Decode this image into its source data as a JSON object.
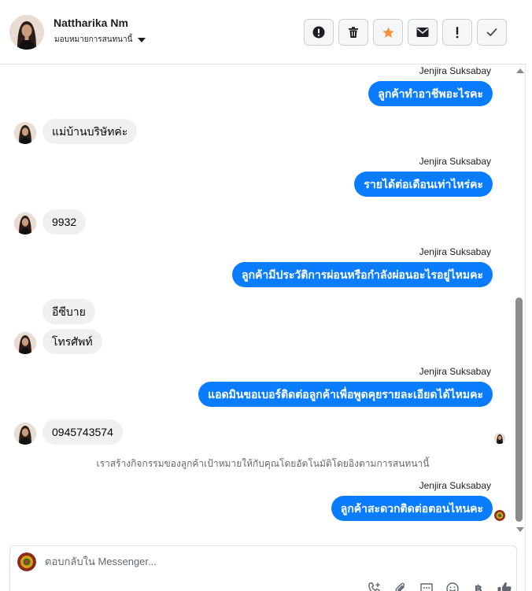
{
  "header": {
    "contact_name": "Nattharika Nm",
    "assign_label": "มอบหมายการสนทนานี้"
  },
  "actions": [
    {
      "icon": "alert-circle-icon"
    },
    {
      "icon": "trash-icon"
    },
    {
      "icon": "star-icon",
      "color": "#f7923b"
    },
    {
      "icon": "mail-icon"
    },
    {
      "icon": "exclamation-icon"
    },
    {
      "icon": "check-icon"
    }
  ],
  "conversation": {
    "sender_name": "Jenjira Suksabay",
    "messages": [
      {
        "direction": "out",
        "text": "ลูกค้าทำอาชีพอะไรคะ"
      },
      {
        "direction": "in",
        "text": "แม่บ้านบริษัทค่ะ"
      },
      {
        "direction": "out",
        "text": "รายได้ต่อเดือนเท่าไหร่คะ"
      },
      {
        "direction": "in",
        "text": "9932"
      },
      {
        "direction": "out",
        "text": "ลูกค้ามีประวัติการผ่อนหรือกำลังผ่อนอะไรอยู่ไหมคะ"
      },
      {
        "direction": "in",
        "text": "อีซีบาย"
      },
      {
        "direction": "in",
        "text": "โทรศัพท์"
      },
      {
        "direction": "out",
        "text": "แอดมินขอเบอร์ติดต่อลูกค้าเพื่อพูดคุยรายละเอียดได้ไหมคะ"
      },
      {
        "direction": "in",
        "text": "0945743574"
      },
      {
        "direction": "out",
        "text": "ลูกค้าสะดวกติดต่อตอนไหนคะ"
      }
    ],
    "system_message": "เราสร้างกิจกรรมของลูกค้าเป้าหมายให้กับคุณโดยอัตโนมัติโดยอิงตามการสนทนานี้"
  },
  "reply": {
    "placeholder": "ตอบกลับใน Messenger...",
    "tools": [
      "phone-add-icon",
      "paperclip-icon",
      "chat-dots-icon",
      "emoji-icon",
      "baht-icon",
      "thumbs-up-icon"
    ],
    "currency_symbol": "฿"
  },
  "colors": {
    "outgoing_bubble": "#0a7cff",
    "incoming_bubble": "#f0f0f0",
    "scrollbar_thumb": "#8c8c8c"
  }
}
